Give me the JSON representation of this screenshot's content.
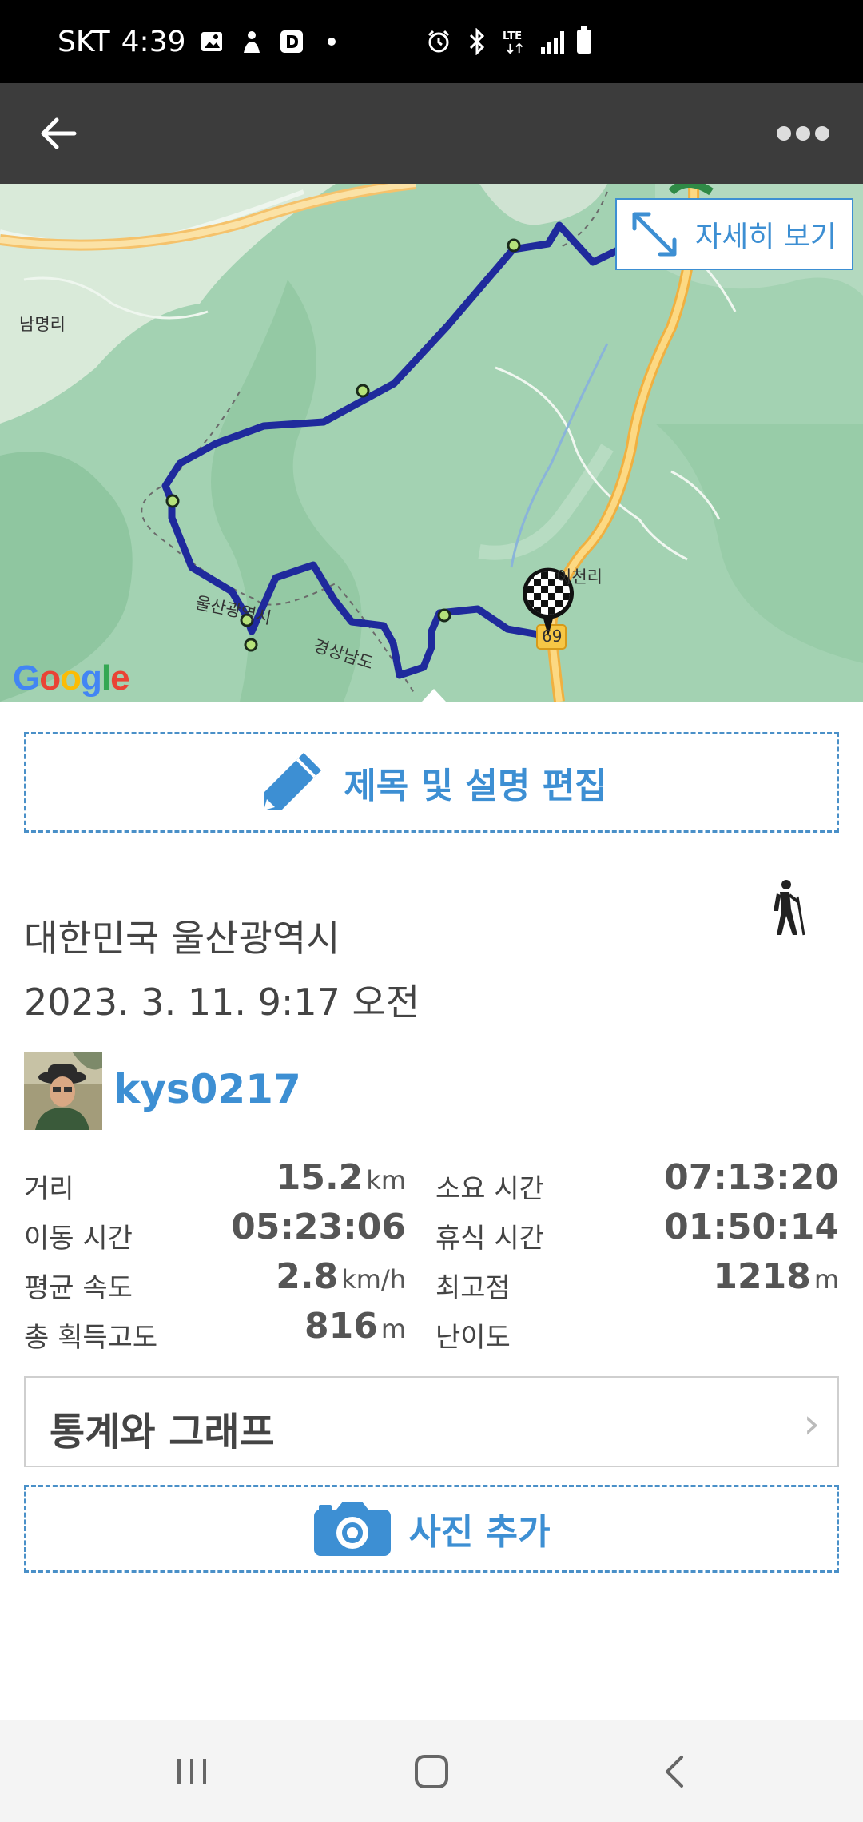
{
  "status_bar": {
    "carrier": "SKT",
    "time": "4:39",
    "network": "LTE",
    "icons": [
      "image-icon",
      "app-icon",
      "d-app-icon",
      "dot-icon",
      "alarm-icon",
      "bluetooth-icon",
      "lte-icon",
      "signal-icon",
      "battery-icon"
    ]
  },
  "header": {
    "back_icon": "arrow-left-icon",
    "more_icon": "more-dots-icon"
  },
  "map": {
    "detail_label": "자세히 보기",
    "google_logo": "Google",
    "labels": {
      "village_nw": "남명리",
      "ulsan": "울산광역시",
      "gyeongnam": "경상남도",
      "icheon": "이천리",
      "route_no": "69"
    },
    "route_color": "#1f2a9c",
    "finish_icon": "checkered-flag-icon"
  },
  "edit_button": {
    "label": "제목 및 설명 편집",
    "icon": "pencil-icon"
  },
  "activity": {
    "type_icon": "hiker-icon",
    "location": "대한민국 울산광역시",
    "datetime": "2023. 3. 11. 9:17 오전"
  },
  "user": {
    "username": "kys0217"
  },
  "stats": [
    {
      "label": "거리",
      "value": "15.2",
      "unit": "km",
      "label2": "소요 시간",
      "value2": "07:13:20",
      "unit2": ""
    },
    {
      "label": "이동 시간",
      "value": "05:23:06",
      "unit": "",
      "label2": "휴식 시간",
      "value2": "01:50:14",
      "unit2": ""
    },
    {
      "label": "평균 속도",
      "value": "2.8",
      "unit": "km/h",
      "label2": "최고점",
      "value2": "1218",
      "unit2": "m"
    },
    {
      "label": "총 획득고도",
      "value": "816",
      "unit": "m",
      "label2": "난이도",
      "value2": "",
      "unit2": ""
    }
  ],
  "stats_graph": {
    "label": "통계와 그래프",
    "chevron": "›"
  },
  "photo_button": {
    "label": "사진 추가",
    "icon": "camera-icon"
  },
  "nav_bar": {
    "recents_icon": "recents-icon",
    "home_icon": "home-icon",
    "back_icon": "nav-back-icon"
  },
  "colors": {
    "accent": "#3d8fd3",
    "header": "#3c3c3c",
    "map_green": "#9fcfae"
  }
}
